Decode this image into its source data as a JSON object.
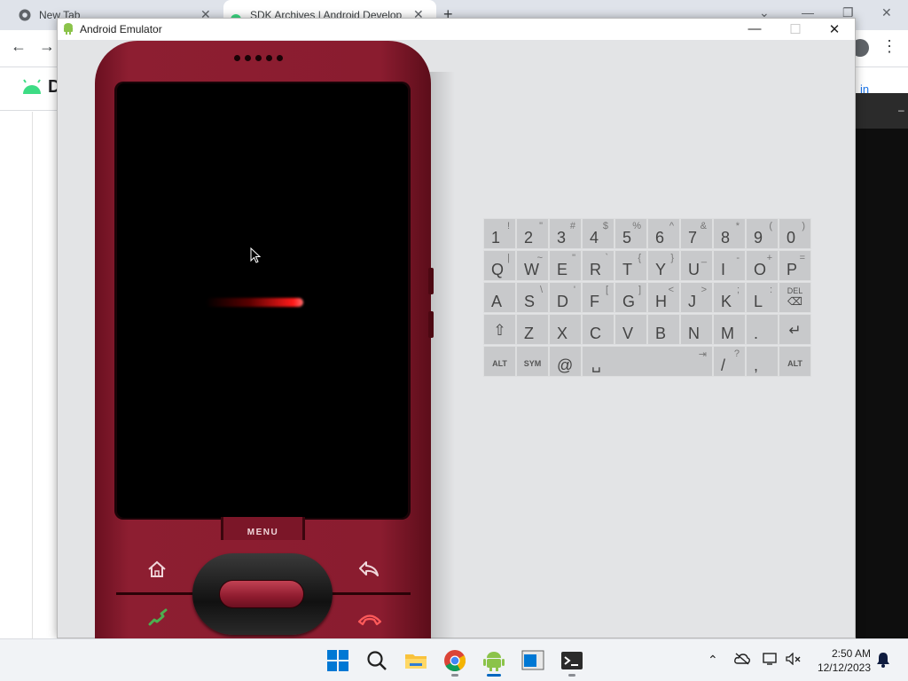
{
  "browser": {
    "tabs": [
      {
        "title": "New Tab"
      },
      {
        "title": "SDK Archives | Android Develop"
      }
    ],
    "header": {
      "letter": "D",
      "signin": "in"
    },
    "dark_panel": {
      "text": "–"
    }
  },
  "emulator": {
    "title": "Android Emulator",
    "menu_label": "MENU",
    "keyboard": {
      "rows": [
        [
          {
            "m": "1",
            "a": "!"
          },
          {
            "m": "2",
            "a": "\""
          },
          {
            "m": "3",
            "a": "#"
          },
          {
            "m": "4",
            "a": "$"
          },
          {
            "m": "5",
            "a": "%"
          },
          {
            "m": "6",
            "a": "^"
          },
          {
            "m": "7",
            "a": "&"
          },
          {
            "m": "8",
            "a": "*"
          },
          {
            "m": "9",
            "a": "("
          },
          {
            "m": "0",
            "a": ")"
          }
        ],
        [
          {
            "m": "Q",
            "a": "|"
          },
          {
            "m": "W",
            "a": "~"
          },
          {
            "m": "E",
            "a": "\""
          },
          {
            "m": "R",
            "a": "`"
          },
          {
            "m": "T",
            "a": "{"
          },
          {
            "m": "Y",
            "a": "}"
          },
          {
            "m": "U",
            "a": "_"
          },
          {
            "m": "I",
            "a": "-"
          },
          {
            "m": "O",
            "a": "+"
          },
          {
            "m": "P",
            "a": "="
          }
        ],
        [
          {
            "m": "A",
            "a": ""
          },
          {
            "m": "S",
            "a": "\\"
          },
          {
            "m": "D",
            "a": "'"
          },
          {
            "m": "F",
            "a": "["
          },
          {
            "m": "G",
            "a": "]"
          },
          {
            "m": "H",
            "a": "<"
          },
          {
            "m": "J",
            "a": ">"
          },
          {
            "m": "K",
            "a": ";"
          },
          {
            "m": "L",
            "a": ":"
          },
          {
            "m": "DEL",
            "a": ""
          }
        ],
        [
          {
            "m": "⇧",
            "a": ""
          },
          {
            "m": "Z",
            "a": ""
          },
          {
            "m": "X",
            "a": ""
          },
          {
            "m": "C",
            "a": ""
          },
          {
            "m": "V",
            "a": ""
          },
          {
            "m": "B",
            "a": ""
          },
          {
            "m": "N",
            "a": ""
          },
          {
            "m": "M",
            "a": ""
          },
          {
            "m": ".",
            "a": ""
          },
          {
            "m": "↵",
            "a": ""
          }
        ],
        [
          {
            "m": "ALT",
            "a": ""
          },
          {
            "m": "SYM",
            "a": ""
          },
          {
            "m": "@",
            "a": ""
          },
          {
            "m": "␣",
            "a": "⇥"
          },
          {
            "m": "/",
            "a": "?"
          },
          {
            "m": ",",
            "a": ""
          },
          {
            "m": "ALT",
            "a": ""
          }
        ]
      ]
    }
  },
  "taskbar": {
    "time": "2:50 AM",
    "date": "12/12/2023"
  },
  "icons": {
    "accent_green": "#3ddc84",
    "phone_body": "#8a1c2f",
    "boot_red": "#ff1a1a"
  }
}
